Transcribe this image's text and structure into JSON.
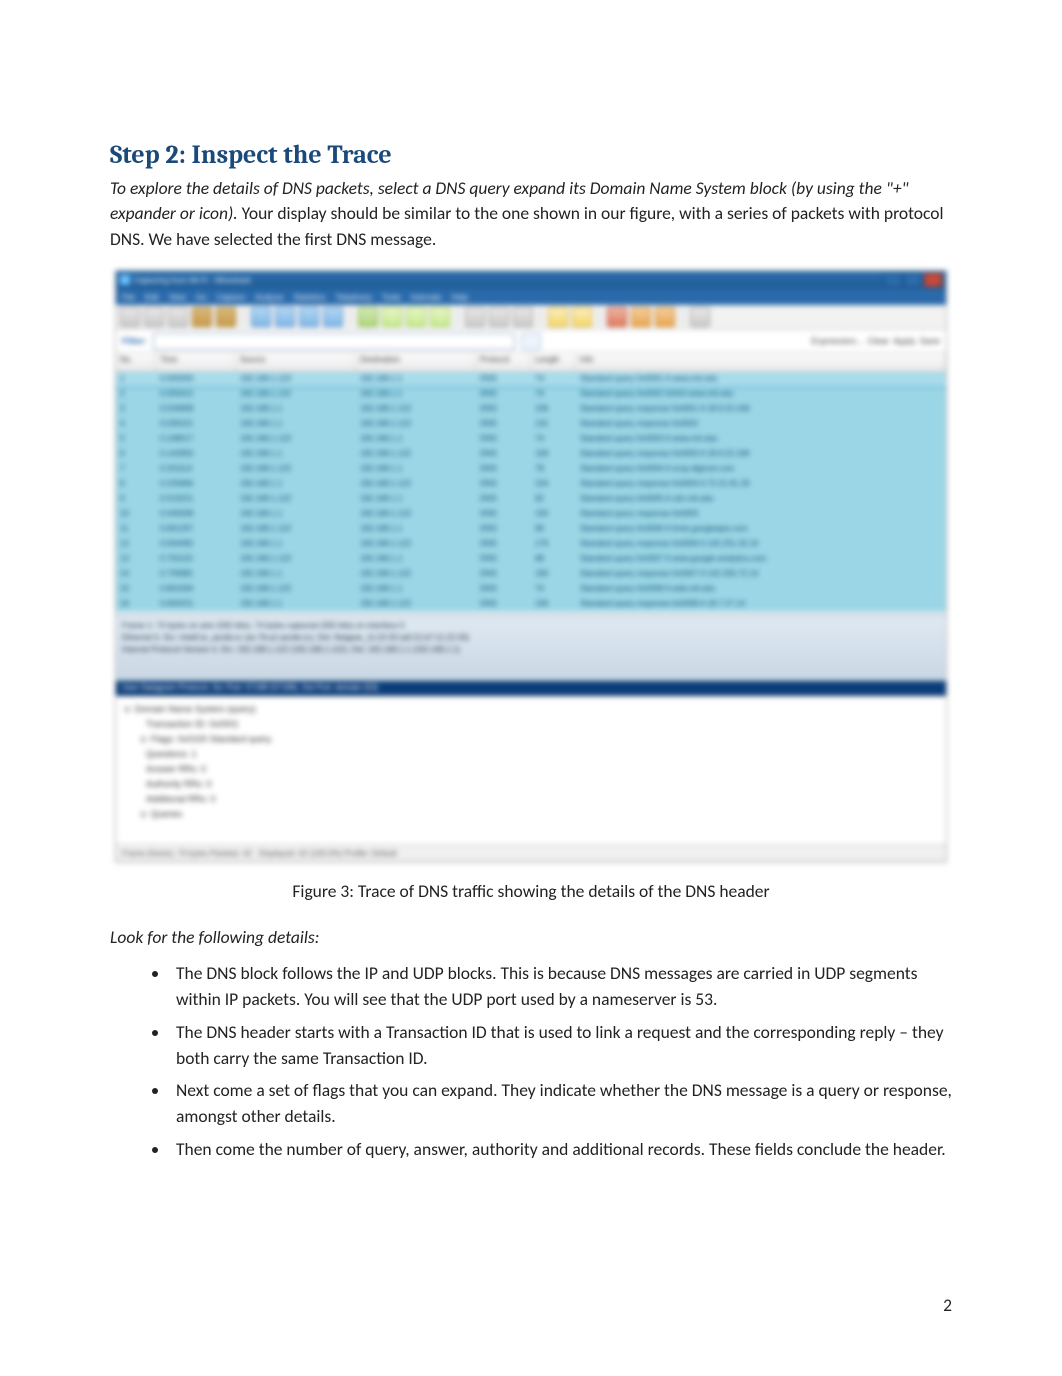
{
  "heading": "Step 2: Inspect the Trace",
  "intro_italic": "To explore the details of DNS packets, select a DNS query expand its Domain Name System block (by using the \"+\" expander or icon).",
  "intro_rest": " Your display should be similar to the one shown in our figure, with a series of packets with protocol DNS. We have selected the first DNS message.",
  "figure_caption": "Figure 3: Trace of DNS traffic showing the details of the DNS header",
  "look_for": "Look for the following details:",
  "bullets": [
    "The DNS block follows the IP and UDP blocks. This is because DNS messages are carried in UDP segments within IP packets. You will see that the UDP port used by a nameserver is 53.",
    "The DNS header starts with a Transaction ID that is used to link a request and the corresponding reply – they both carry the same Transaction ID.",
    "Next come a set of flags that you can expand. They indicate whether the DNS message is a query or response, amongst other details.",
    "Then come the number of query, answer, authority and additional records. These fields conclude the header."
  ],
  "page_number": "2",
  "screenshot": {
    "title": "Capturing from Wi-Fi - Wireshark",
    "menus": [
      "File",
      "Edit",
      "View",
      "Go",
      "Capture",
      "Analyze",
      "Statistics",
      "Telephony",
      "Tools",
      "Internals",
      "Help"
    ],
    "filter_label": "Filter:",
    "expression_label": "Expression...",
    "clear_label": "Clear",
    "apply_label": "Apply",
    "save_label": "Save",
    "columns": [
      "No.",
      "Time",
      "Source",
      "Destination",
      "Protocol",
      "Length",
      "Info"
    ],
    "rows": [
      [
        "1",
        "0.000000",
        "192.168.1.122",
        "192.168.1.1",
        "DNS",
        "74",
        "Standard query 0x0001  A www.mit.edu"
      ],
      [
        "2",
        "0.000412",
        "192.168.1.122",
        "192.168.1.1",
        "DNS",
        "74",
        "Standard query 0x0002  AAAA www.mit.edu"
      ],
      [
        "3",
        "0.034908",
        "192.168.1.1",
        "192.168.1.122",
        "DNS",
        "106",
        "Standard query response 0x0001  A 18.9.22.169"
      ],
      [
        "4",
        "0.035221",
        "192.168.1.1",
        "192.168.1.122",
        "DNS",
        "131",
        "Standard query response 0x0002"
      ],
      [
        "5",
        "0.108017",
        "192.168.1.122",
        "192.168.1.1",
        "DNS",
        "74",
        "Standard query 0x0003  A www.mit.edu"
      ],
      [
        "6",
        "0.142650",
        "192.168.1.1",
        "192.168.1.122",
        "DNS",
        "106",
        "Standard query response 0x0003  A 18.9.22.169"
      ],
      [
        "7",
        "0.201114",
        "192.168.1.122",
        "192.168.1.1",
        "DNS",
        "78",
        "Standard query 0x0004  A ocsp.digicert.com"
      ],
      [
        "8",
        "0.233484",
        "192.168.1.1",
        "192.168.1.122",
        "DNS",
        "224",
        "Standard query response 0x0004  A 72.21.91.29"
      ],
      [
        "9",
        "0.510221",
        "192.168.1.122",
        "192.168.1.1",
        "DNS",
        "82",
        "Standard query 0x0005  A cdn.mit.edu"
      ],
      [
        "10",
        "0.545008",
        "192.168.1.1",
        "192.168.1.122",
        "DNS",
        "150",
        "Standard query response 0x0005"
      ],
      [
        "11",
        "0.601337",
        "192.168.1.122",
        "192.168.1.1",
        "DNS",
        "86",
        "Standard query 0x0006  A fonts.googleapis.com"
      ],
      [
        "12",
        "0.634492",
        "192.168.1.1",
        "192.168.1.122",
        "DNS",
        "176",
        "Standard query response 0x0006  A 142.251.32.10"
      ],
      [
        "13",
        "0.702115",
        "192.168.1.122",
        "192.168.1.1",
        "DNS",
        "88",
        "Standard query 0x0007  A www.google-analytics.com"
      ],
      [
        "14",
        "0.735881",
        "192.168.1.1",
        "192.168.1.122",
        "DNS",
        "190",
        "Standard query response 0x0007  A 142.250.72.14"
      ],
      [
        "15",
        "0.801004",
        "192.168.1.122",
        "192.168.1.1",
        "DNS",
        "74",
        "Standard query 0x0008  A web.mit.edu"
      ],
      [
        "16",
        "0.834221",
        "192.168.1.1",
        "192.168.1.122",
        "DNS",
        "106",
        "Standard query response 0x0008  A 18.7.27.14"
      ]
    ],
    "middle_frame": "Frame 1: 74 bytes on wire (592 bits), 74 bytes captured (592 bits) on interface 0",
    "middle_eth": "Ethernet II, Src: IntelCor_aa:bb:cc (ac:7b:a1:aa:bb:cc), Dst: Netgear_11:22:33 (a0:21:b7:11:22:33)",
    "middle_ip": "Internet Protocol Version 4, Src: 192.168.1.122 (192.168.1.122), Dst: 192.168.1.1 (192.168.1.1)",
    "middle_sel": "User Datagram Protocol, Src Port: 57189 (57189), Dst Port: domain (53)",
    "detail_root": "Domain Name System (query)",
    "detail_items": [
      "Transaction ID: 0x0001",
      "Flags: 0x0100 Standard query",
      "Questions: 1",
      "Answer RRs: 0",
      "Authority RRs: 0",
      "Additional RRs: 0",
      "Queries"
    ],
    "status": "Frame (frame), 74 bytes              Packets: 42 · Displayed: 42 (100.0%)             Profile: Default"
  }
}
